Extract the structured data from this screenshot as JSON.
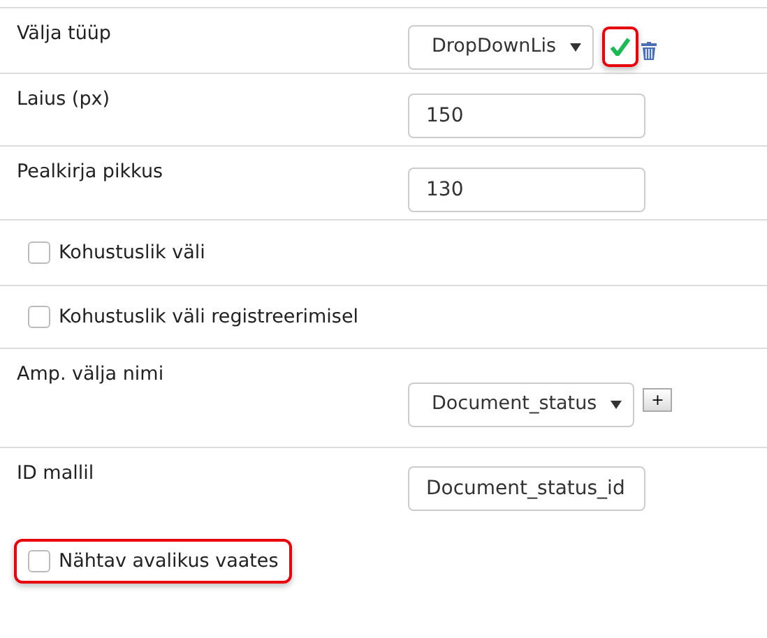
{
  "rows": [
    {
      "kind": "select",
      "label": "Välja tüüp",
      "value": "DropDownLis",
      "actions": [
        {
          "kind": "confirm",
          "highlighted": true
        },
        {
          "kind": "delete",
          "highlighted": false
        }
      ]
    },
    {
      "kind": "input",
      "label": "Laius (px)",
      "value": "150"
    },
    {
      "kind": "input",
      "label": "Pealkirja pikkus",
      "value": "130"
    },
    {
      "kind": "checkbox",
      "label": "Kohustuslik väli",
      "checked": false,
      "highlighted": false
    },
    {
      "kind": "checkbox",
      "label": "Kohustuslik väli registreerimisel",
      "checked": false,
      "highlighted": false
    },
    {
      "kind": "select",
      "label": "Amp. välja nimi",
      "value": "Document_status",
      "actions": [
        {
          "kind": "add",
          "text": "+"
        }
      ]
    },
    {
      "kind": "input",
      "label": "ID mallil",
      "value": "Document_status_id"
    },
    {
      "kind": "checkbox",
      "label": "Nähtav avalikus vaates",
      "checked": false,
      "highlighted": true
    }
  ]
}
